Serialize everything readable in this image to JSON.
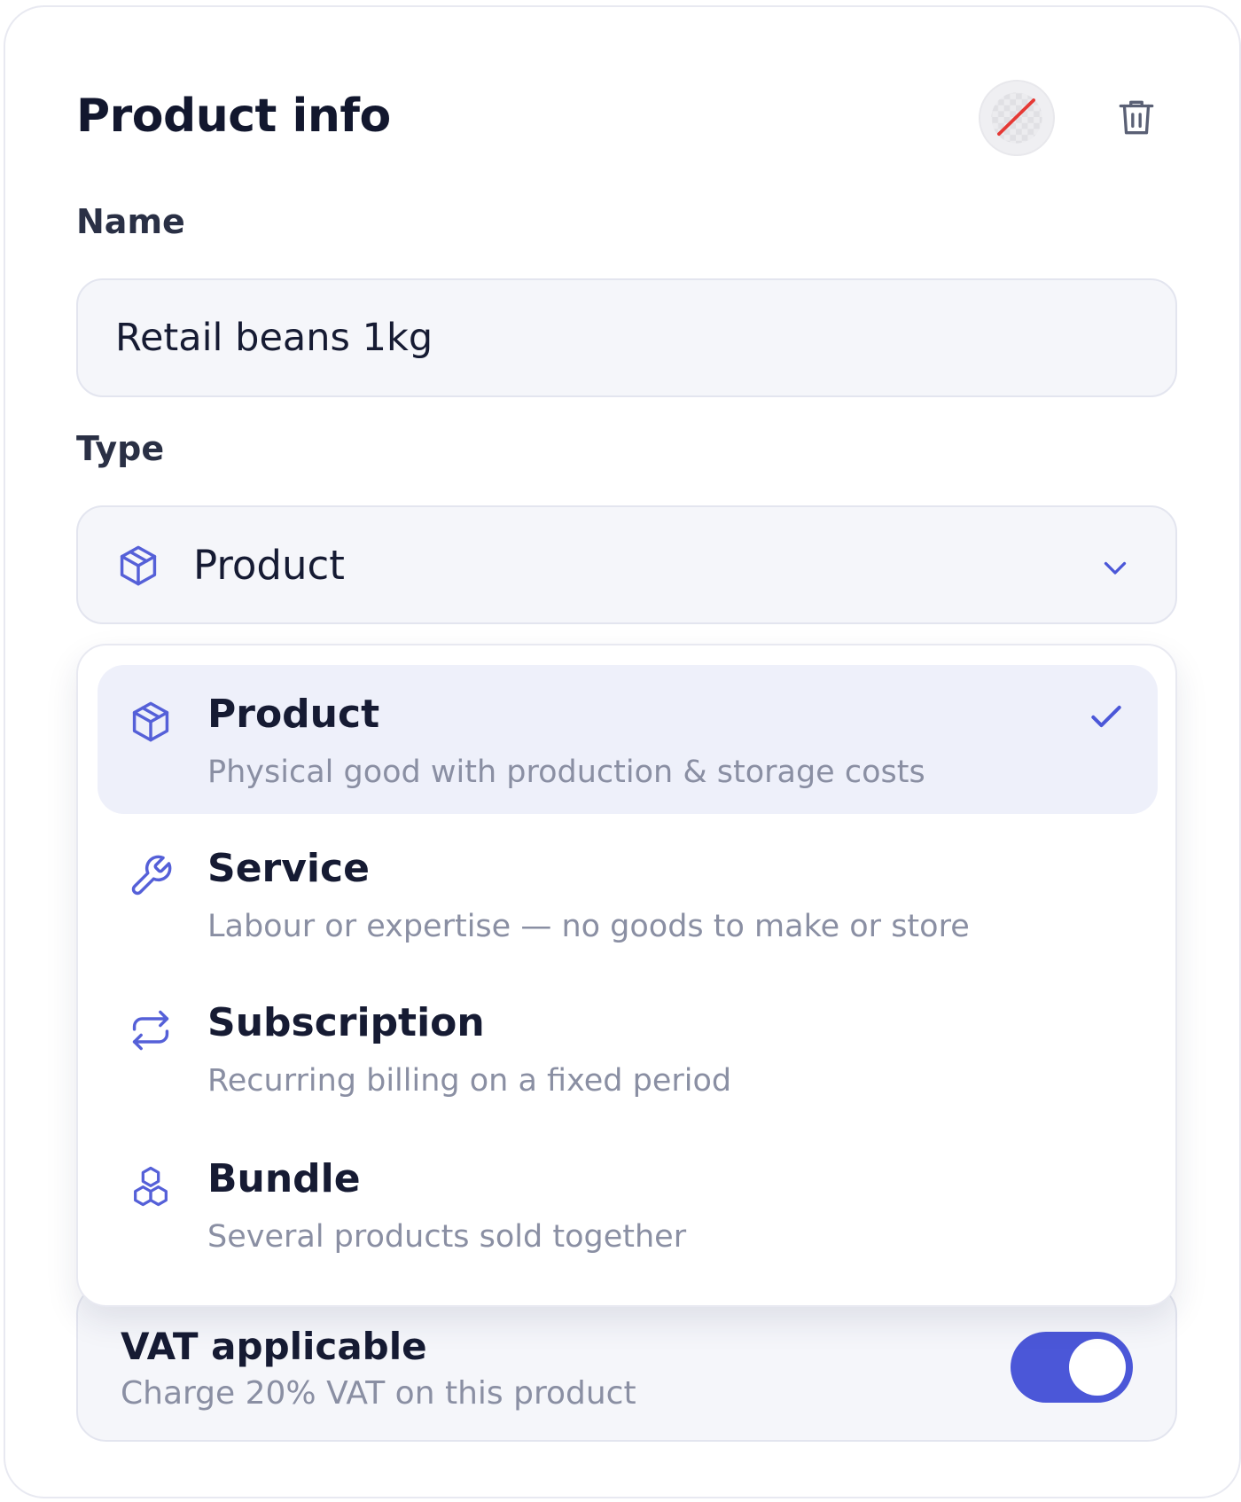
{
  "panel": {
    "title": "Product info"
  },
  "name_field": {
    "label": "Name",
    "value": "Retail beans 1kg"
  },
  "type_field": {
    "label": "Type",
    "selected": "Product",
    "selected_icon": "box-icon"
  },
  "type_options": [
    {
      "title": "Product",
      "description": "Physical good with production & storage costs",
      "icon": "box-icon",
      "selected": true
    },
    {
      "title": "Service",
      "description": "Labour or expertise — no goods to make or store",
      "icon": "wrench-icon",
      "selected": false
    },
    {
      "title": "Subscription",
      "description": "Recurring billing on a fixed period",
      "icon": "repeat-icon",
      "selected": false
    },
    {
      "title": "Bundle",
      "description": "Several products sold together",
      "icon": "bundle-icon",
      "selected": false
    }
  ],
  "vat": {
    "title": "VAT applicable",
    "description": "Charge 20% VAT on this product",
    "enabled": true
  },
  "colors": {
    "accent": "#4b57d8",
    "icon": "#5560d8",
    "selected_bg": "#eef0fa",
    "field_bg": "#f5f6fa",
    "muted_text": "#8a8fa3",
    "no_color_slash": "#e53935"
  }
}
